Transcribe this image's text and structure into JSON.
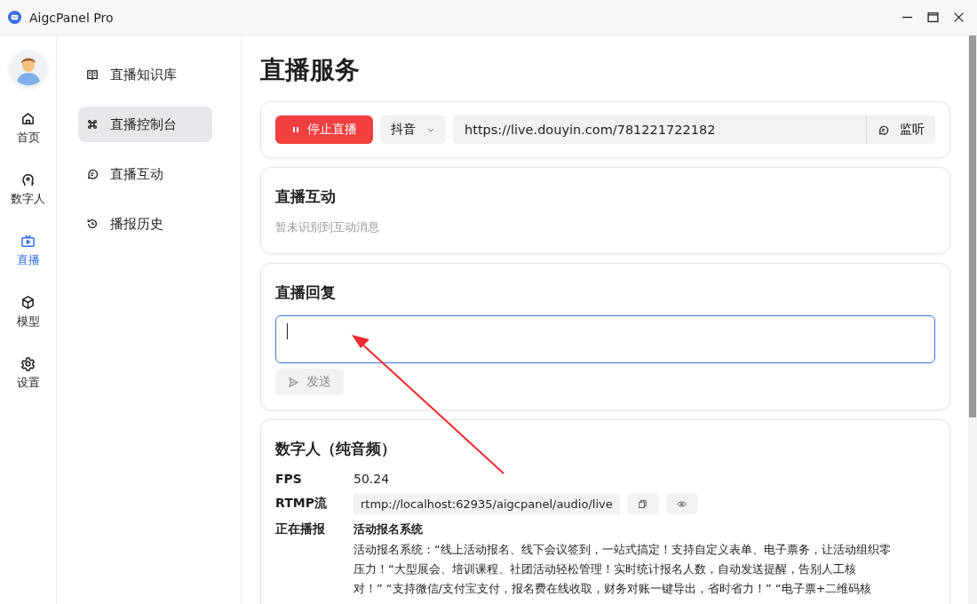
{
  "window": {
    "title": "AigcPanel Pro"
  },
  "rail": [
    {
      "label": "首页",
      "selected": false
    },
    {
      "label": "数字人",
      "selected": false
    },
    {
      "label": "直播",
      "selected": true
    },
    {
      "label": "模型",
      "selected": false
    },
    {
      "label": "设置",
      "selected": false
    }
  ],
  "submenu": [
    {
      "label": "直播知识库",
      "selected": false
    },
    {
      "label": "直播控制台",
      "selected": true
    },
    {
      "label": "直播互动",
      "selected": false
    },
    {
      "label": "播报历史",
      "selected": false
    }
  ],
  "page_title": "直播服务",
  "control": {
    "stop_button": "停止直播",
    "platform": "抖音",
    "url": "https://live.douyin.com/781221722182",
    "listen_button": "监听"
  },
  "interaction": {
    "title": "直播互动",
    "empty": "暂未识别到互动消息"
  },
  "reply": {
    "title": "直播回复",
    "send_button": "发送"
  },
  "avatar": {
    "title": "数字人（纯音频）",
    "fps_label": "FPS",
    "fps": "50.24",
    "rtmp_label": "RTMP流",
    "rtmp": "rtmp://localhost:62935/aigcpanel/audio/live",
    "playing_label": "正在播报",
    "playing_title": "活动报名系统",
    "playing_lines": [
      "活动报名系统：“线上活动报名、线下会议签到，一站式搞定！支持自定义表单、电子票务，让活动组织零",
      "压力！“大型展会、培训课程、社团活动轻松管理！实时统计报名人数，自动发送提醒，告别人工核",
      "对！”  “支持微信/支付宝支付，报名费在线收取，财务对账一键导出，省时省力！”  “电子票+二维码核"
    ]
  }
}
